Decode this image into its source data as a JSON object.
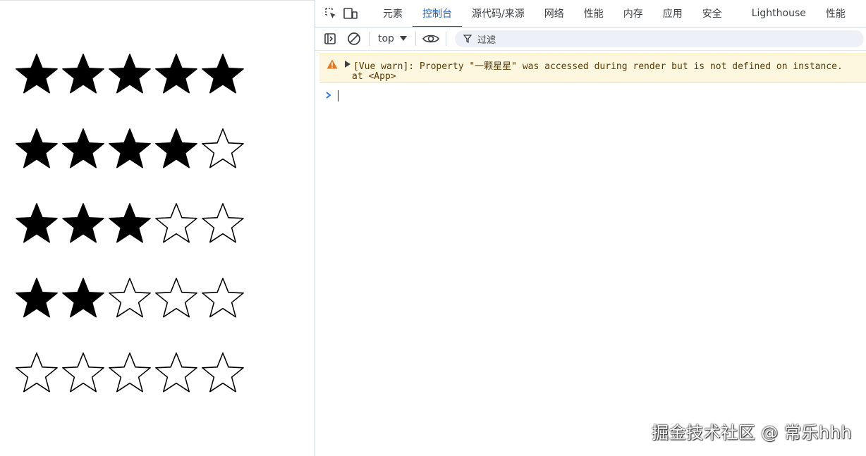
{
  "ratings": [
    {
      "stars": 5,
      "max": 5
    },
    {
      "stars": 4,
      "max": 5
    },
    {
      "stars": 3,
      "max": 5
    },
    {
      "stars": 2,
      "max": 5
    },
    {
      "stars": 0,
      "max": 5
    }
  ],
  "devtools": {
    "tabs": [
      "元素",
      "控制台",
      "源代码/来源",
      "网络",
      "性能",
      "内存",
      "应用",
      "安全",
      "Lighthouse",
      "性能"
    ],
    "active_tab": "控制台",
    "context": "top",
    "filter_placeholder": "过滤",
    "accent_color": "#1a5fcf"
  },
  "console": {
    "warning": {
      "line1": "[Vue warn]: Property \"一颗星星\" was accessed during render but is not defined on instance.",
      "line2": "at <App>",
      "color": "#fef7e0"
    },
    "prompt_symbol": "›"
  },
  "watermark": "掘金技术社区 @ 常乐hhh"
}
